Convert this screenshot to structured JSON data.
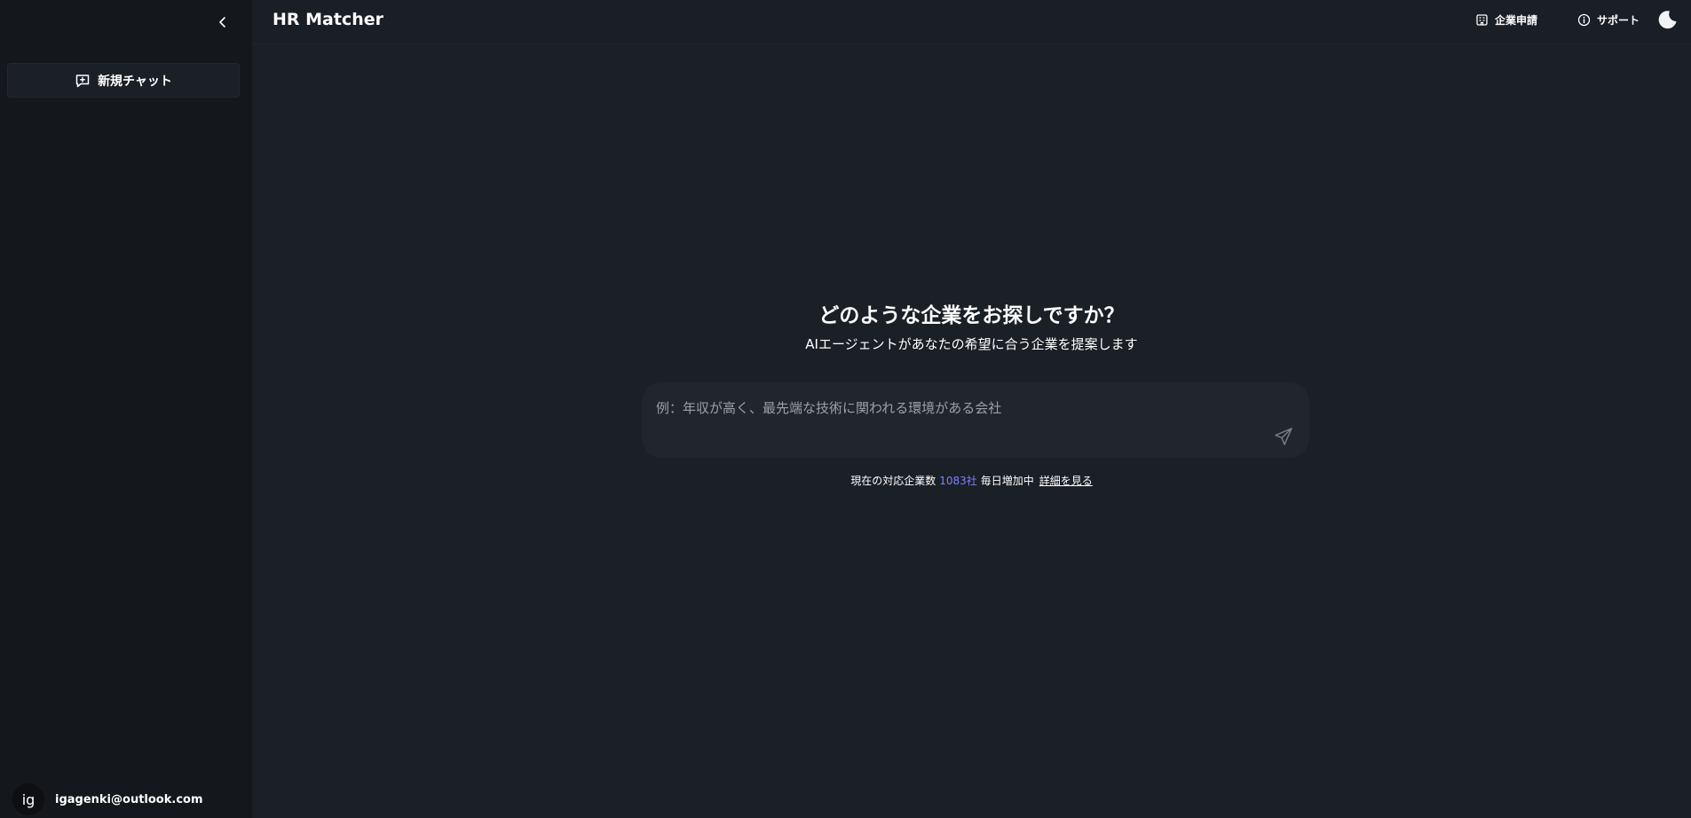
{
  "sidebar": {
    "new_chat_label": "新規チャット",
    "user": {
      "avatar_initials": "ig",
      "email": "igagenki@outlook.com"
    }
  },
  "header": {
    "title": "HR Matcher",
    "company_apply_label": "企業申請",
    "support_label": "サポート"
  },
  "hero": {
    "title": "どのような企業をお探しですか？",
    "subtitle": "AIエージェントがあなたの希望に合う企業を提案します"
  },
  "composer": {
    "placeholder": "例：年収が高く、最先端な技術に関われる環境がある会社",
    "value": ""
  },
  "info": {
    "prefix": "現在の対応企業数",
    "count": "1083社",
    "suffix": "毎日増加中",
    "details_link": "詳細を見る"
  },
  "colors": {
    "accent": "#7b82ff",
    "background": "#1b1f26",
    "sidebar": "#14171b"
  }
}
